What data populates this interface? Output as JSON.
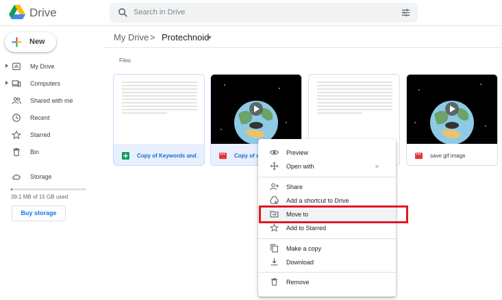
{
  "app": {
    "brand": "Drive"
  },
  "search": {
    "placeholder": "Search in Drive"
  },
  "sidebar": {
    "new_label": "New",
    "items": [
      {
        "label": "My Drive",
        "icon": "my-drive-icon"
      },
      {
        "label": "Computers",
        "icon": "computers-icon"
      },
      {
        "label": "Shared with me",
        "icon": "shared-icon"
      },
      {
        "label": "Recent",
        "icon": "clock-icon"
      },
      {
        "label": "Starred",
        "icon": "star-icon"
      },
      {
        "label": "Bin",
        "icon": "trash-icon"
      }
    ],
    "storage_label": "Storage",
    "storage_text": "39.1 MB of 15 GB used",
    "storage_fraction": 0.003,
    "buy_label": "Buy storage"
  },
  "breadcrumb": {
    "root": "My Drive",
    "separator": ">",
    "current": "Protechnoid"
  },
  "section_label": "Files",
  "files": [
    {
      "name": "Copy of Keywords and ...",
      "type": "sheets",
      "selected": true
    },
    {
      "name": "Copy of s",
      "type": "video",
      "selected": true
    },
    {
      "name": "",
      "type": "sheets",
      "selected": false
    },
    {
      "name": "save gif image",
      "type": "video",
      "selected": false
    }
  ],
  "context_menu": {
    "items": [
      {
        "label": "Preview",
        "icon": "eye-icon"
      },
      {
        "label": "Open with",
        "icon": "open-with-icon",
        "submenu": ">"
      },
      {
        "label": "Share",
        "icon": "share-person-icon"
      },
      {
        "label": "Add a shortcut to Drive",
        "icon": "shortcut-icon"
      },
      {
        "label": "Move to",
        "icon": "move-folder-icon",
        "highlighted": true
      },
      {
        "label": "Add to Starred",
        "icon": "star-icon"
      },
      {
        "label": "Make a copy",
        "icon": "copy-icon"
      },
      {
        "label": "Download",
        "icon": "download-icon"
      },
      {
        "label": "Remove",
        "icon": "trash-icon"
      }
    ]
  },
  "colors": {
    "accent": "#1a73e8",
    "highlight_box": "#e21622",
    "selected_bg": "#e8f0fe"
  }
}
